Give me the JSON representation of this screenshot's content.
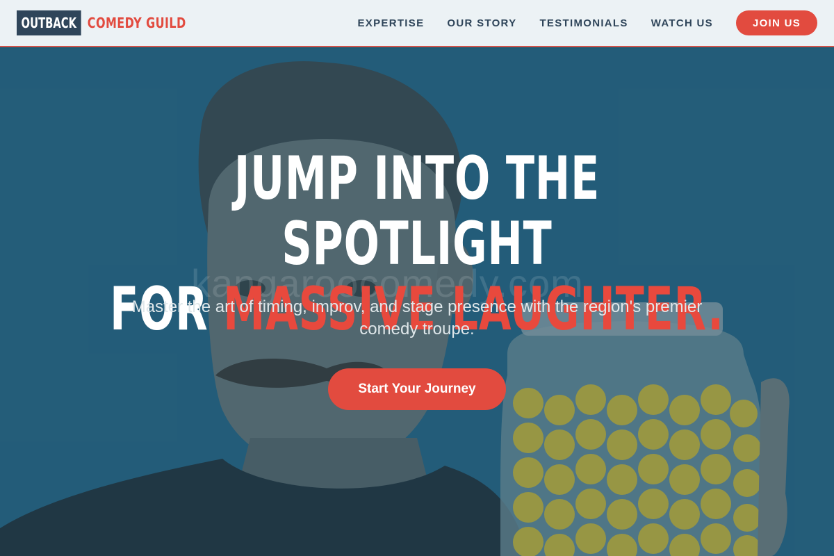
{
  "brand": {
    "box_text": "OUTBACK",
    "text": "COMEDY GUILD"
  },
  "nav": {
    "items": [
      {
        "label": "EXPERTISE"
      },
      {
        "label": "OUR STORY"
      },
      {
        "label": "TESTIMONIALS"
      },
      {
        "label": "WATCH US"
      }
    ],
    "cta_label": "JOIN US"
  },
  "hero": {
    "headline_line1": "JUMP INTO THE SPOTLIGHT",
    "headline_line2_prefix": "FOR ",
    "headline_line2_accent": "MASSIVE LAUGHTER.",
    "subtitle": "Master the art of timing, improv, and stage presence with the region's premier comedy troupe.",
    "cta_label": "Start Your Journey",
    "watermark": "kangaroocomedy.com"
  },
  "colors": {
    "accent": "#e24b3f",
    "navy": "#2f455a",
    "header_bg": "#ecf2f5",
    "hero_bg": "#24698a"
  }
}
